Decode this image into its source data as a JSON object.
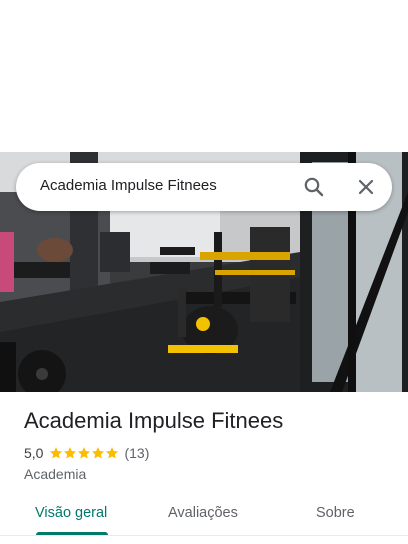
{
  "search": {
    "query": "Academia Impulse Fitnees"
  },
  "place": {
    "name": "Academia Impulse Fitnees",
    "rating": "5,0",
    "stars": 5,
    "review_count": "(13)",
    "category": "Academia"
  },
  "tabs": [
    {
      "label": "Visão geral",
      "active": true
    },
    {
      "label": "Avaliações",
      "active": false
    },
    {
      "label": "Sobre",
      "active": false
    }
  ],
  "colors": {
    "accent": "#00796b",
    "star": "#fbbc04",
    "text_primary": "#202124",
    "text_secondary": "#5f6368"
  },
  "icons": [
    "search-icon",
    "close-icon",
    "star-icon"
  ]
}
